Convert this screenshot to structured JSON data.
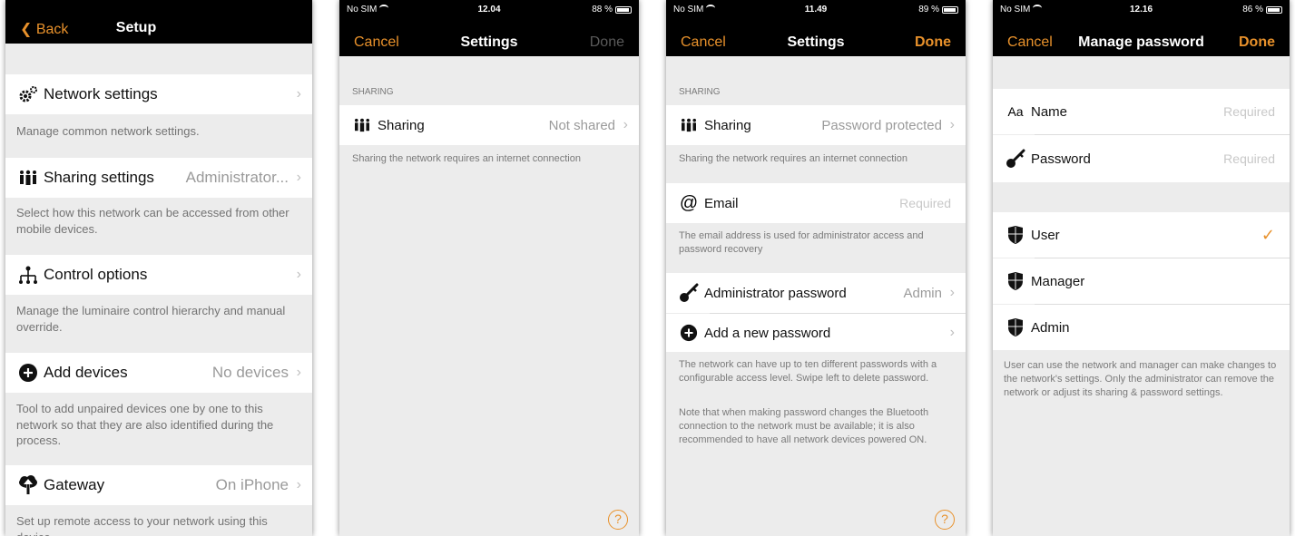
{
  "panel1": {
    "back": "Back",
    "title": "Setup",
    "items": [
      {
        "label": "Network settings",
        "value": "",
        "desc": "Manage common network settings.",
        "icon": "gears-icon"
      },
      {
        "label": "Sharing settings",
        "value": "Administrator...",
        "desc": "Select how this network can be accessed from other mobile devices.",
        "icon": "people-icon"
      },
      {
        "label": "Control options",
        "value": "",
        "desc": "Manage the luminaire control hierarchy and manual override.",
        "icon": "hierarchy-icon"
      },
      {
        "label": "Add devices",
        "value": "No devices",
        "desc": "Tool to add unpaired devices one by one to this network so that they are also identified during the process.",
        "icon": "plus-circle-icon"
      },
      {
        "label": "Gateway",
        "value": "On iPhone",
        "desc": "Set up remote access to your network using this device.",
        "icon": "cloud-upload-icon"
      }
    ]
  },
  "panel2": {
    "carrier": "No SIM",
    "time": "12.04",
    "battery": "88 %",
    "cancel": "Cancel",
    "title": "Settings",
    "done": "Done",
    "section": "SHARING",
    "sharing_label": "Sharing",
    "sharing_value": "Not shared",
    "note": "Sharing the network requires an internet connection",
    "help": "?"
  },
  "panel3": {
    "carrier": "No SIM",
    "time": "11.49",
    "battery": "89 %",
    "cancel": "Cancel",
    "title": "Settings",
    "done": "Done",
    "section": "SHARING",
    "sharing_label": "Sharing",
    "sharing_value": "Password protected",
    "note": "Sharing the network requires an internet connection",
    "email_label": "Email",
    "email_placeholder": "Required",
    "email_note": "The email address is used for administrator access and password recovery",
    "admin_label": "Administrator password",
    "admin_value": "Admin",
    "add_label": "Add a new password",
    "note2": "The network can have up to ten different passwords with a configurable access level. Swipe left to delete password.",
    "note3": "Note that when making password changes the Bluetooth connection to the network must be available; it is also recommended to have all network devices powered ON.",
    "help": "?"
  },
  "panel4": {
    "carrier": "No SIM",
    "time": "12.16",
    "battery": "86 %",
    "cancel": "Cancel",
    "title": "Manage password",
    "done": "Done",
    "name_icon": "Aa",
    "name_label": "Name",
    "name_placeholder": "Required",
    "password_label": "Password",
    "password_placeholder": "Required",
    "levels": [
      "User",
      "Manager",
      "Admin"
    ],
    "selected": "User",
    "note": "User can use the network and manager can make changes to the network's settings. Only the administrator can remove the network or adjust its sharing & password settings."
  },
  "colors": {
    "accent": "#e8912b",
    "navbar": "#000000",
    "background": "#ececec"
  }
}
